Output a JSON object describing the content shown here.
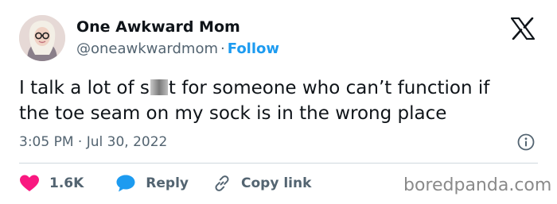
{
  "author": {
    "display_name": "One Awkward Mom",
    "handle": "@oneawkwardmom",
    "separator": "·",
    "follow_label": "Follow"
  },
  "tweet": {
    "line1_before": "I talk a lot of s",
    "line1_after": "t for someone who can’t function if",
    "line2": "the toe seam on my sock is in the wrong place",
    "timestamp": "3:05 PM · Jul 30, 2022"
  },
  "actions": {
    "like_count": "1.6K",
    "reply_label": "Reply",
    "copy_link_label": "Copy link"
  },
  "watermark": "boredpanda.com",
  "icons": {
    "platform": "x-logo-icon",
    "info": "info-icon",
    "like": "heart-icon",
    "reply": "speech-bubble-icon",
    "copy_link": "link-icon"
  },
  "colors": {
    "like": "#f91880",
    "reply": "#1d9bf0",
    "follow": "#1d9bf0",
    "secondary_text": "#536471"
  }
}
